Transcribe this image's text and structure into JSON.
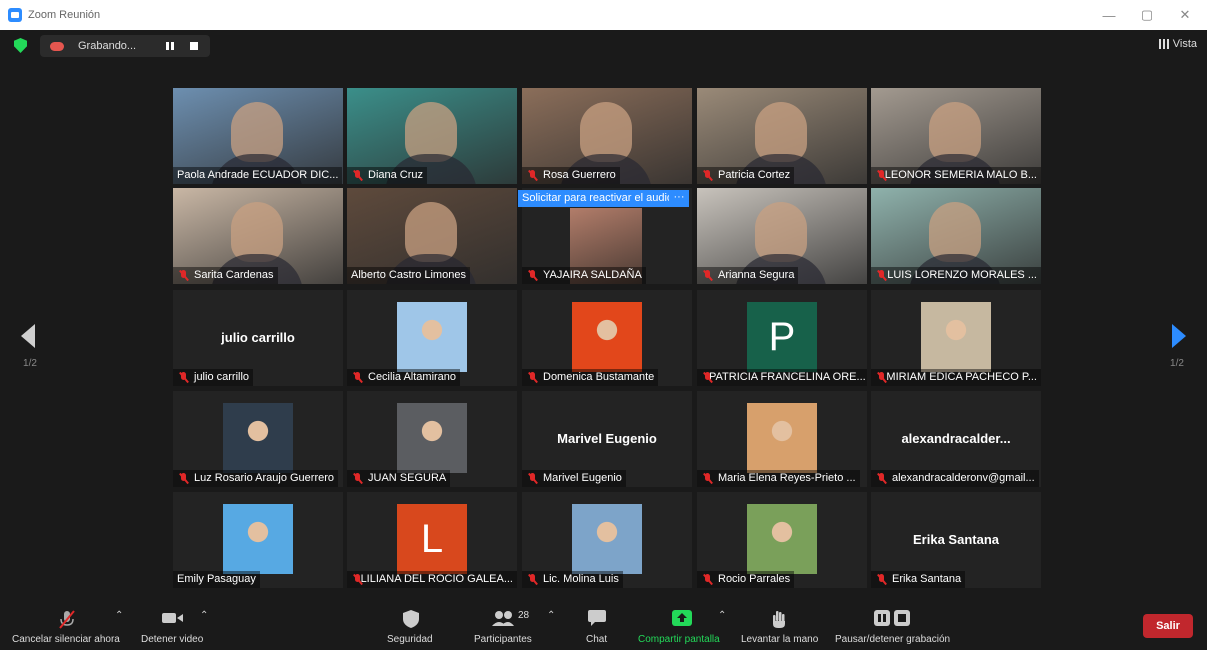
{
  "window": {
    "title": "Zoom Reunión",
    "controls": [
      "—",
      "▢",
      "✕"
    ]
  },
  "top": {
    "recording_label": "Grabando...",
    "view_label": "Vista"
  },
  "pagination": {
    "prev_page": "1/2",
    "next_page": "1/2"
  },
  "tooltip": {
    "text": "Solicitar para reactivar el audio",
    "more": "···"
  },
  "participants": [
    {
      "name": "Paola Andrade ECUADOR DIC...",
      "muted": false,
      "type": "video",
      "bg": "#6d8fb0"
    },
    {
      "name": "Diana Cruz",
      "muted": true,
      "type": "video",
      "bg": "#3b8f8a"
    },
    {
      "name": "Rosa Guerrero",
      "muted": true,
      "type": "video",
      "bg": "#8b6e5a"
    },
    {
      "name": "Patricia Cortez",
      "muted": true,
      "type": "video",
      "bg": "#9a8a78"
    },
    {
      "name": "LEONOR SEMERIA MALO B...",
      "muted": true,
      "type": "video",
      "bg": "#a39a90"
    },
    {
      "name": "Sarita Cardenas",
      "muted": true,
      "type": "video",
      "bg": "#c9b7a5"
    },
    {
      "name": "Alberto Castro Limones",
      "muted": false,
      "type": "video",
      "bg": "#5e4a3c",
      "active": true
    },
    {
      "name": "YAJAIRA SALDAÑA",
      "muted": true,
      "type": "video-small",
      "bg": "#b27d6a"
    },
    {
      "name": "Arianna Segura",
      "muted": true,
      "type": "video",
      "bg": "#c8c3bc"
    },
    {
      "name": "LUIS LORENZO MORALES ...",
      "muted": true,
      "type": "video",
      "bg": "#8fb2ac"
    },
    {
      "name": "julio carrillo",
      "muted": true,
      "type": "text",
      "display": "julio carrillo"
    },
    {
      "name": "Cecilia Altamirano",
      "muted": true,
      "type": "thumb",
      "bg": "#9fc6e8"
    },
    {
      "name": "Domenica Bustamante",
      "muted": true,
      "type": "thumb",
      "bg": "#e2471b"
    },
    {
      "name": "PATRICIA FRANCELINA ORE...",
      "muted": true,
      "type": "letter",
      "letter": "P",
      "bg": "#17614a"
    },
    {
      "name": "MIRIAM EDICA PACHECO P...",
      "muted": true,
      "type": "thumb",
      "bg": "#c6b8a0"
    },
    {
      "name": "Luz Rosario Araujo Guerrero",
      "muted": true,
      "type": "thumb",
      "bg": "#2f3d4c"
    },
    {
      "name": "JUAN SEGURA",
      "muted": true,
      "type": "thumb",
      "bg": "#5b5d61"
    },
    {
      "name": "Marivel Eugenio",
      "muted": true,
      "type": "text",
      "display": "Marivel Eugenio"
    },
    {
      "name": "Maria Elena Reyes-Prieto ...",
      "muted": true,
      "type": "thumb",
      "bg": "#d7a06c"
    },
    {
      "name": "alexandracalderonv@gmail...",
      "muted": true,
      "type": "text",
      "display": "alexandracalder..."
    },
    {
      "name": "Emily Pasaguay",
      "muted": false,
      "type": "thumb",
      "bg": "#57a9e3"
    },
    {
      "name": "LILIANA DEL ROCIO GALEA...",
      "muted": true,
      "type": "letter",
      "letter": "L",
      "bg": "#d8481d"
    },
    {
      "name": "Lic. Molina Luis",
      "muted": true,
      "type": "thumb",
      "bg": "#7da4c9"
    },
    {
      "name": "Rocio Parrales",
      "muted": true,
      "type": "thumb",
      "bg": "#7aa05a"
    },
    {
      "name": "Erika Santana",
      "muted": true,
      "type": "text",
      "display": "Erika Santana"
    }
  ],
  "toolbar": {
    "unmute": "Cancelar silenciar ahora",
    "stop_video": "Detener video",
    "security": "Seguridad",
    "participants": "Participantes",
    "participants_count": "28",
    "chat": "Chat",
    "share": "Compartir pantalla",
    "raise_hand": "Levantar la mano",
    "pause_recording": "Pausar/detener grabación",
    "leave": "Salir"
  },
  "colors": {
    "accent": "#2d8cff",
    "share_green": "#23d959",
    "leave_red": "#c1272d",
    "active_speaker": "#d8e05a"
  }
}
